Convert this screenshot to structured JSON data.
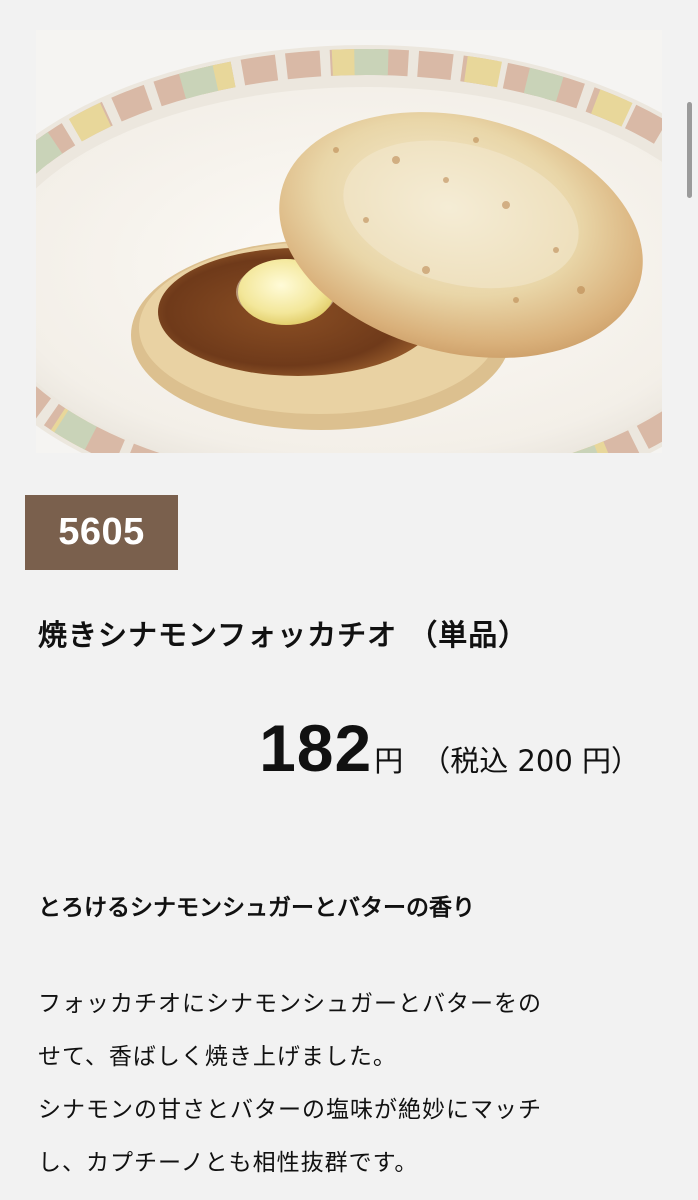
{
  "product": {
    "code": "5605",
    "name": "焼きシナモンフォッカチオ （単品）",
    "price": "182",
    "price_unit": "円",
    "price_tax_included": "（税込 200 円）",
    "tagline": "とろけるシナモンシュガーとバターの香り",
    "description_lines": [
      "フォッカチオにシナモンシュガーとバターをの",
      "せて、香ばしく焼き上げました。",
      "シナモンの甘さとバターの塩味が絶妙にマッチ",
      "し、カプチーノとも相性抜群です。"
    ]
  }
}
